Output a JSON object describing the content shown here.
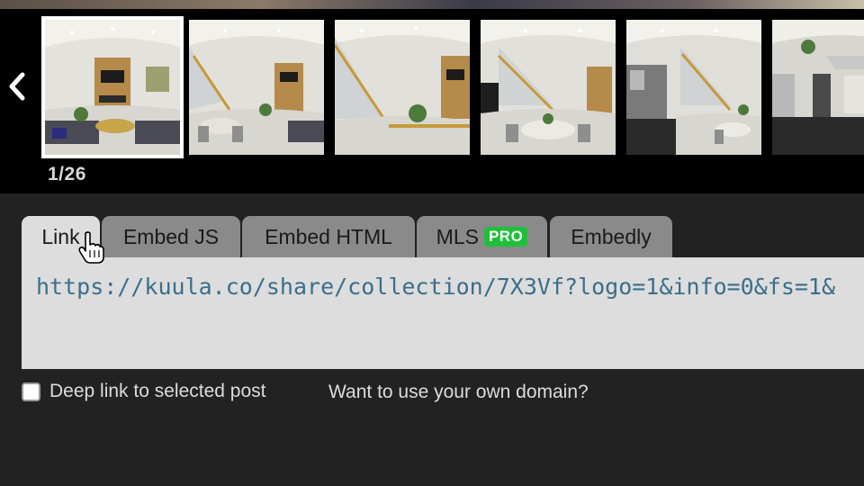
{
  "gallery": {
    "prev_icon": "chevron-left-icon",
    "counter": "1/26",
    "thumbnails": [
      {
        "scene": "living-room",
        "selected": true
      },
      {
        "scene": "dining-stairs",
        "selected": false
      },
      {
        "scene": "stairs-hall",
        "selected": false
      },
      {
        "scene": "dining-table",
        "selected": false
      },
      {
        "scene": "kitchen-dining",
        "selected": false
      },
      {
        "scene": "kitchen",
        "selected": false
      }
    ]
  },
  "tabs": [
    {
      "label": "Link",
      "active": true
    },
    {
      "label": "Embed JS",
      "active": false
    },
    {
      "label": "Embed HTML",
      "active": false
    },
    {
      "label": "MLS",
      "badge": "PRO",
      "active": false
    },
    {
      "label": "Embedly",
      "active": false
    }
  ],
  "link": {
    "url": "https://kuula.co/share/collection/7X3Vf?logo=1&info=0&fs=1&"
  },
  "options": {
    "deep_link_label": "Deep link to selected post",
    "deep_link_checked": false,
    "domain_link": "Want to use your own domain?"
  },
  "colors": {
    "background": "#222222",
    "gallery_bg": "#000000",
    "tab_active": "#dddddd",
    "tab_inactive": "#8a8a8a",
    "pro_badge": "#1fbf3a",
    "url_text": "#3c6e8a"
  }
}
